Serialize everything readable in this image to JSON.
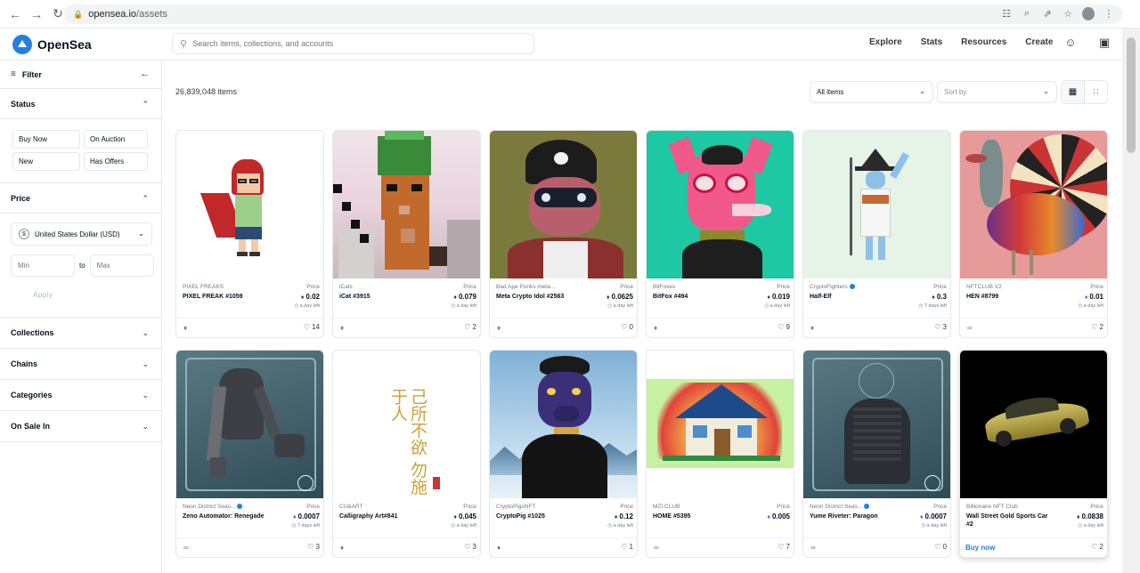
{
  "browser": {
    "domain": "opensea.io",
    "path": "/assets"
  },
  "header": {
    "brand": "OpenSea",
    "search_placeholder": "Search items, collections, and accounts",
    "nav": [
      "Explore",
      "Stats",
      "Resources",
      "Create"
    ]
  },
  "sidebar": {
    "filter_label": "Filter",
    "status_title": "Status",
    "status_options": [
      "Buy Now",
      "On Auction",
      "New",
      "Has Offers"
    ],
    "price_title": "Price",
    "currency": "United States Dollar (USD)",
    "min_placeholder": "Min",
    "to_label": "to",
    "max_placeholder": "Max",
    "apply_label": "Apply",
    "sections": [
      "Collections",
      "Chains",
      "Categories",
      "On Sale In"
    ]
  },
  "main": {
    "items_count": "26,839,048 items",
    "filter_select": "All items",
    "sort_placeholder": "Sort by"
  },
  "price_label": "Price",
  "colors": {
    "accent": "#2081e2",
    "brand": "#2081e2"
  },
  "cards": [
    {
      "collection": "PIXEL FREAKS",
      "verified": false,
      "name": "PIXEL FREAK #1059",
      "price": "0.02",
      "currency": "eth",
      "time_left": "a day left",
      "chain": "eth",
      "favorites": "14"
    },
    {
      "collection": "iCats",
      "verified": false,
      "name": "iCat #3915",
      "price": "0.079",
      "currency": "eth",
      "time_left": "a day left",
      "chain": "eth",
      "favorites": "2"
    },
    {
      "collection": "Bad Ape Punks meta...",
      "verified": false,
      "name": "Meta Crypto Idol #2563",
      "price": "0.0625",
      "currency": "eth",
      "time_left": "a day left",
      "chain": "eth",
      "favorites": "0"
    },
    {
      "collection": "BitFoxes",
      "verified": false,
      "name": "BitFox #494",
      "price": "0.019",
      "currency": "eth",
      "time_left": "a day left",
      "chain": "eth",
      "favorites": "9"
    },
    {
      "collection": "CryptoFighters",
      "verified": true,
      "name": "Half-Elf",
      "price": "0.3",
      "currency": "eth",
      "time_left": "7 days left",
      "chain": "eth",
      "favorites": "3"
    },
    {
      "collection": "NFTCLUB V2",
      "verified": false,
      "name": "HEN #8799",
      "price": "0.01",
      "currency": "poly",
      "time_left": "a day left",
      "chain": "link",
      "favorites": "2"
    },
    {
      "collection": "Neon District Seas...",
      "verified": true,
      "name": "Zeno Automator: Renegade",
      "price": "0.0007",
      "currency": "poly",
      "time_left": "7 days left",
      "chain": "link",
      "favorites": "3"
    },
    {
      "collection": "CU&ART",
      "verified": false,
      "name": "Calligraphy Art#841",
      "price": "0.045",
      "currency": "eth",
      "time_left": "a day left",
      "chain": "eth",
      "favorites": "3"
    },
    {
      "collection": "CryptoPigsNFT",
      "verified": false,
      "name": "CryptoPig #1025",
      "price": "0.12",
      "currency": "eth",
      "time_left": "a day left",
      "chain": "eth",
      "favorites": "1"
    },
    {
      "collection": "MZI CLUB",
      "verified": false,
      "name": "HOME #5395",
      "price": "0.005",
      "currency": "poly",
      "time_left": "",
      "chain": "link",
      "favorites": "7"
    },
    {
      "collection": "Neon District Seas...",
      "verified": true,
      "name": "Yume Riveter: Paragon",
      "price": "0.0007",
      "currency": "poly",
      "time_left": "a day left",
      "chain": "link",
      "favorites": "0"
    },
    {
      "collection": "Billionaire NFT Club",
      "verified": false,
      "name": "Wall Street Gold Sports Car #2",
      "price": "0.0838",
      "currency": "eth",
      "time_left": "a day left",
      "chain": "buy",
      "buy_label": "Buy now",
      "favorites": "2"
    }
  ],
  "calligraphy_text": "己所不欲 勿施于人"
}
